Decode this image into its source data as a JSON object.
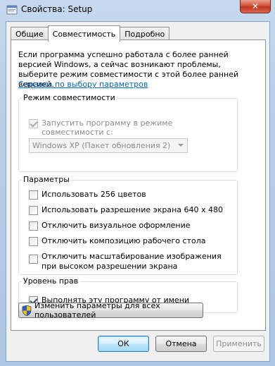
{
  "window": {
    "title": "Свойства: Setup",
    "close_glyph": "✕"
  },
  "tabs": [
    {
      "label": "Общие"
    },
    {
      "label": "Совместимость"
    },
    {
      "label": "Подробно"
    }
  ],
  "intro_text": "Если программа успешно работала с более ранней версией Windows, а сейчас возникают проблемы, выберите режим совместимости с этой более ранней версией.",
  "help_link": "Справка по выбору параметров",
  "compat_mode": {
    "group_label": "Режим совместимости",
    "checkbox_label": "Запустить программу в режиме совместимости с:",
    "checked": true,
    "select_value": "Windows XP (Пакет обновления 2)"
  },
  "settings": {
    "group_label": "Параметры",
    "options": [
      {
        "label": "Использовать 256 цветов",
        "checked": false
      },
      {
        "label": "Использовать разрешение экрана 640 x 480",
        "checked": false
      },
      {
        "label": "Отключить визуальное оформление",
        "checked": false
      },
      {
        "label": "Отключить композицию рабочего стола",
        "checked": false
      },
      {
        "label": "Отключить масштабирование изображения при высоком разрешении экрана",
        "checked": false
      }
    ]
  },
  "privilege": {
    "group_label": "Уровень прав",
    "checkbox_label": "Выполнять эту программу от имени администратора",
    "checked": true
  },
  "change_all_button": "Изменить параметры для всех пользователей",
  "buttons": {
    "ok": "ОК",
    "cancel": "Отмена",
    "apply": "Применить"
  },
  "colors": {
    "link": "#0066cc",
    "close_button": "#c2331b",
    "window_frame": "#b9cfe8"
  }
}
